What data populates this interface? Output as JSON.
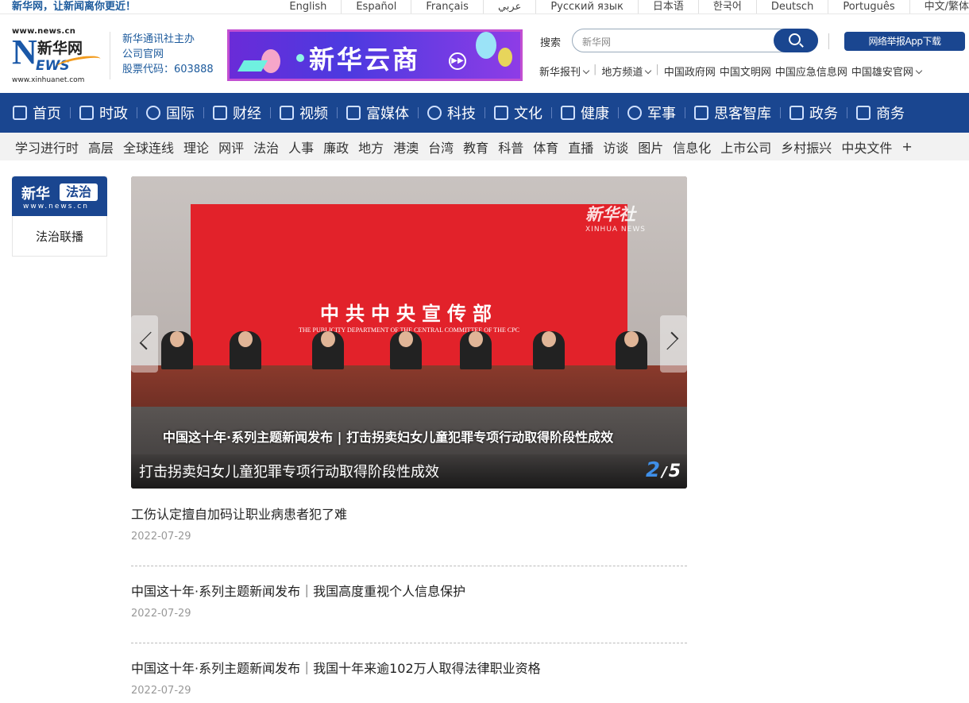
{
  "topbar": {
    "slogan": "新华网，让新闻离你更近！",
    "languages": [
      "English",
      "Español",
      "Français",
      "عربي",
      "Русский язык",
      "日本语",
      "한국어",
      "Deutsch",
      "Português",
      "中文/繁体"
    ]
  },
  "logo": {
    "url_top": "www.news.cn",
    "brand_cn": "新华网",
    "brand_n": "N",
    "brand_ews": "EWS",
    "url_bottom": "www.xinhuanet.com"
  },
  "company": {
    "line1": "新华通讯社主办",
    "line2": "公司官网",
    "line3": "股票代码：603888"
  },
  "banner": {
    "text": "新华云商"
  },
  "search": {
    "label": "搜索",
    "value": "新华网",
    "app_button": "网络举报App下载"
  },
  "sublinks": {
    "baokan": "新华报刊",
    "difang": "地方频道",
    "gov": [
      "中国政府网",
      "中国文明网",
      "中国应急信息网",
      "中国雄安官网"
    ]
  },
  "mainnav": [
    {
      "label": "首页",
      "icon": "home-icon"
    },
    {
      "label": "时政",
      "icon": "document-icon"
    },
    {
      "label": "国际",
      "icon": "globe-icon"
    },
    {
      "label": "财经",
      "icon": "chart-icon"
    },
    {
      "label": "视频",
      "icon": "play-icon"
    },
    {
      "label": "富媒体",
      "icon": "grid-icon"
    },
    {
      "label": "科技",
      "icon": "atom-icon"
    },
    {
      "label": "文化",
      "icon": "book-icon"
    },
    {
      "label": "健康",
      "icon": "heartbeat-icon"
    },
    {
      "label": "军事",
      "icon": "shield-icon"
    },
    {
      "label": "思客智库",
      "icon": "chat-icon"
    },
    {
      "label": "政务",
      "icon": "building-icon"
    },
    {
      "label": "商务",
      "icon": "briefcase-icon"
    }
  ],
  "channels": [
    "学习进行时",
    "高层",
    "全球连线",
    "理论",
    "网评",
    "法治",
    "人事",
    "廉政",
    "地方",
    "港澳",
    "台湾",
    "教育",
    "科普",
    "体育",
    "直播",
    "访谈",
    "图片",
    "信息化",
    "上市公司",
    "乡村振兴",
    "中央文件",
    "+"
  ],
  "sidebar": {
    "brand_a": "新华",
    "brand_b": "法治",
    "brand_url": "www.news.cn",
    "link": "法治联播"
  },
  "carousel": {
    "backdrop_title": "中共中央宣传部",
    "backdrop_en": "THE PUBLICITY DEPARTMENT OF THE CENTRAL COMMITTEE OF THE CPC",
    "watermark_cn": "新华社",
    "watermark_en": "XINHUA NEWS",
    "video_subtitle": "中国这十年·系列主题新闻发布 | 打击拐卖妇女儿童犯罪专项行动取得阶段性成效",
    "caption": "打击拐卖妇女儿童犯罪专项行动取得阶段性成效",
    "current": "2",
    "slash": "/",
    "total": "5"
  },
  "news": [
    {
      "title": "工伤认定擅自加码让职业病患者犯了难",
      "date": "2022-07-29"
    },
    {
      "title": "中国这十年·系列主题新闻发布｜我国高度重视个人信息保护",
      "date": "2022-07-29"
    },
    {
      "title": "中国这十年·系列主题新闻发布｜我国十年来逾102万人取得法律职业资格",
      "date": "2022-07-29"
    }
  ],
  "colors": {
    "brand_blue": "#1a4690",
    "backdrop_red": "#e2222a",
    "counter_blue": "#3f8fe8"
  }
}
